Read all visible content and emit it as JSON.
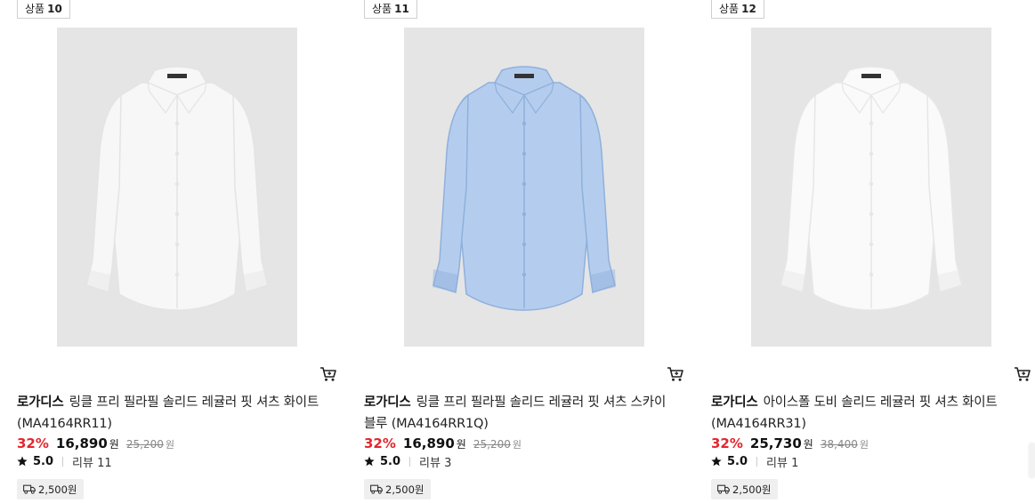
{
  "badge_prefix": "상품",
  "products": [
    {
      "number": "10",
      "brand": "로가디스",
      "name": "링클 프리 필라필 솔리드 레귤러 핏 셔츠 화이트 (MA4164RR11)",
      "discount": "32%",
      "price": "16,890",
      "currency": "원",
      "original_price": "25,200",
      "rating": "5.0",
      "reviews": "리뷰 11",
      "shipping": "2,500원",
      "shirt_color": "#f7f7f7",
      "shirt_shade": "#e4e4e4"
    },
    {
      "number": "11",
      "brand": "로가디스",
      "name": "링클 프리 필라필 솔리드 레귤러 핏 셔츠 스카이 블루 (MA4164RR1Q)",
      "discount": "32%",
      "price": "16,890",
      "currency": "원",
      "original_price": "25,200",
      "rating": "5.0",
      "reviews": "리뷰 3",
      "shipping": "2,500원",
      "shirt_color": "#b4cdee",
      "shirt_shade": "#8fb0dc"
    },
    {
      "number": "12",
      "brand": "로가디스",
      "name": "아이스폴 도비 솔리드 레귤러 핏 셔츠 화이트 (MA4164RR31)",
      "discount": "32%",
      "price": "25,730",
      "currency": "원",
      "original_price": "38,400",
      "rating": "5.0",
      "reviews": "리뷰 1",
      "shipping": "2,500원",
      "shirt_color": "#fafafa",
      "shirt_shade": "#e6e6e6"
    }
  ],
  "icons": {
    "cart": "cart-icon",
    "star": "star-icon",
    "shipping": "truck-icon"
  },
  "colors": {
    "discount": "#e4262d",
    "image_bg": "#e5e5e5",
    "shipping_bg": "#efefef"
  }
}
